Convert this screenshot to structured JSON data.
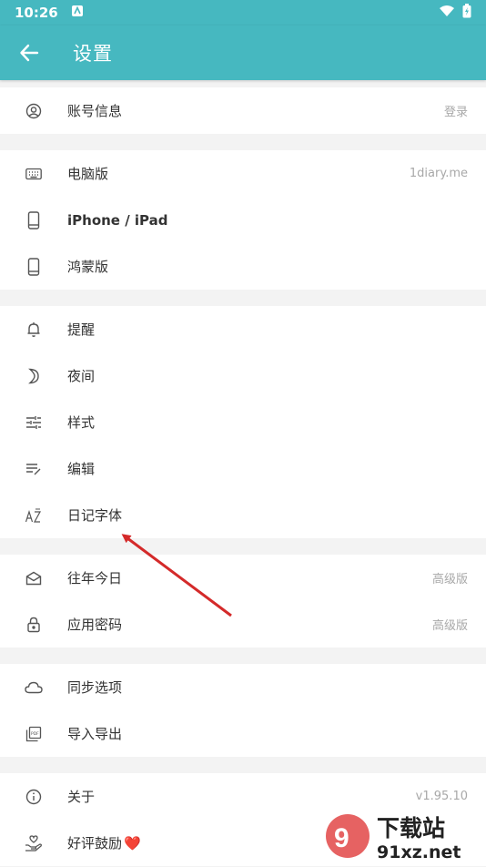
{
  "status_bar": {
    "time": "10:26"
  },
  "header": {
    "title": "设置"
  },
  "sections": [
    {
      "items": [
        {
          "icon": "account-icon",
          "label": "账号信息",
          "value": "登录"
        }
      ]
    },
    {
      "items": [
        {
          "icon": "keyboard-icon",
          "label": "电脑版",
          "value": "1diary.me"
        },
        {
          "icon": "phone-icon",
          "label": "iPhone / iPad",
          "value": ""
        },
        {
          "icon": "phone-icon",
          "label": "鸿蒙版",
          "value": ""
        }
      ]
    },
    {
      "items": [
        {
          "icon": "bell-icon",
          "label": "提醒",
          "value": ""
        },
        {
          "icon": "moon-icon",
          "label": "夜间",
          "value": ""
        },
        {
          "icon": "sliders-icon",
          "label": "样式",
          "value": ""
        },
        {
          "icon": "edit-icon",
          "label": "编辑",
          "value": ""
        },
        {
          "icon": "font-az-icon",
          "label": "日记字体",
          "value": ""
        }
      ]
    },
    {
      "items": [
        {
          "icon": "envelope-icon",
          "label": "往年今日",
          "value": "高级版"
        },
        {
          "icon": "lock-icon",
          "label": "应用密码",
          "value": "高级版"
        }
      ]
    },
    {
      "items": [
        {
          "icon": "cloud-icon",
          "label": "同步选项",
          "value": ""
        },
        {
          "icon": "pdf-icon",
          "label": "导入导出",
          "value": ""
        }
      ]
    },
    {
      "items": [
        {
          "icon": "info-icon",
          "label": "关于",
          "value": "v1.95.10"
        },
        {
          "icon": "hand-heart-icon",
          "label": "好评鼓励",
          "value": ""
        }
      ]
    }
  ],
  "colors": {
    "primary": "#46b8c0",
    "annotation_arrow": "#d42a2a"
  },
  "watermark": {
    "text": "下载站",
    "domain": "91xz.net"
  }
}
